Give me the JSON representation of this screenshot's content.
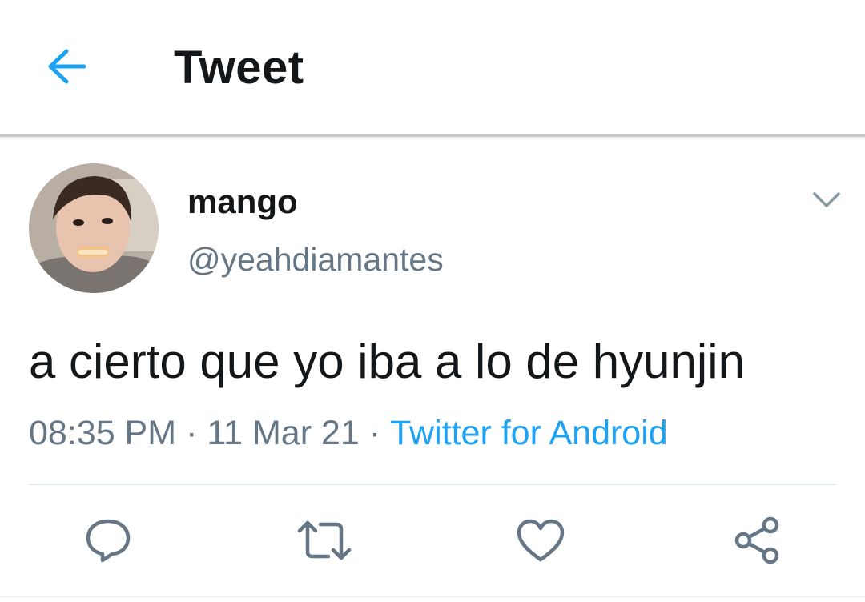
{
  "header": {
    "back_icon": "arrow-left-icon",
    "title": "Tweet"
  },
  "tweet": {
    "display_name": "mango",
    "handle": "@yeahdiamantes",
    "text": "a cierto que yo iba a lo de hyunjin",
    "time": "08:35 PM",
    "separator": "·",
    "date": "11 Mar 21",
    "source": "Twitter for Android",
    "menu_icon": "chevron-down-icon"
  },
  "actions": [
    {
      "name": "reply",
      "icon": "speech-bubble-icon"
    },
    {
      "name": "retweet",
      "icon": "retweet-arrows-icon"
    },
    {
      "name": "like",
      "icon": "heart-icon"
    },
    {
      "name": "share",
      "icon": "share-nodes-icon"
    }
  ],
  "colors": {
    "accent": "#1da1f2",
    "text_primary": "#14171a",
    "text_secondary": "#657786",
    "divider": "#e1e8ed"
  }
}
